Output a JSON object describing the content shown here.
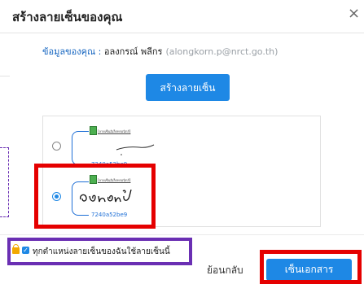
{
  "dialog": {
    "title": "สร้างลายเซ็นของคุณ",
    "close_symbol": "×"
  },
  "user_info": {
    "label": "ข้อมูลของคุณ",
    "separator": " : ",
    "name": "อลงกรณ์ พลีกร",
    "email": "(alongkorn.p@nrct.go.th)"
  },
  "create_button": {
    "label": "สร้างลายเซ็น"
  },
  "signatures": [
    {
      "code": "7240a52be9",
      "selected": false,
      "header": "[ลายเซ็นอิเล็กทรอนิกส์]"
    },
    {
      "code": "7240a52be9",
      "selected": true,
      "header": "[ลายเซ็นอิเล็กทรอนิกส์]"
    }
  ],
  "apply_all": {
    "label": "ทุกตำแหน่งลายเซ็นของฉันใช้ลายเซ็นนี้",
    "checked": true
  },
  "footer": {
    "back_label": "ย้อนกลับ",
    "sign_label": "เซ็นเอกสาร"
  },
  "colors": {
    "accent": "#1e88e5",
    "highlight_red": "#e50000",
    "highlight_purple": "#6a2fb3"
  }
}
